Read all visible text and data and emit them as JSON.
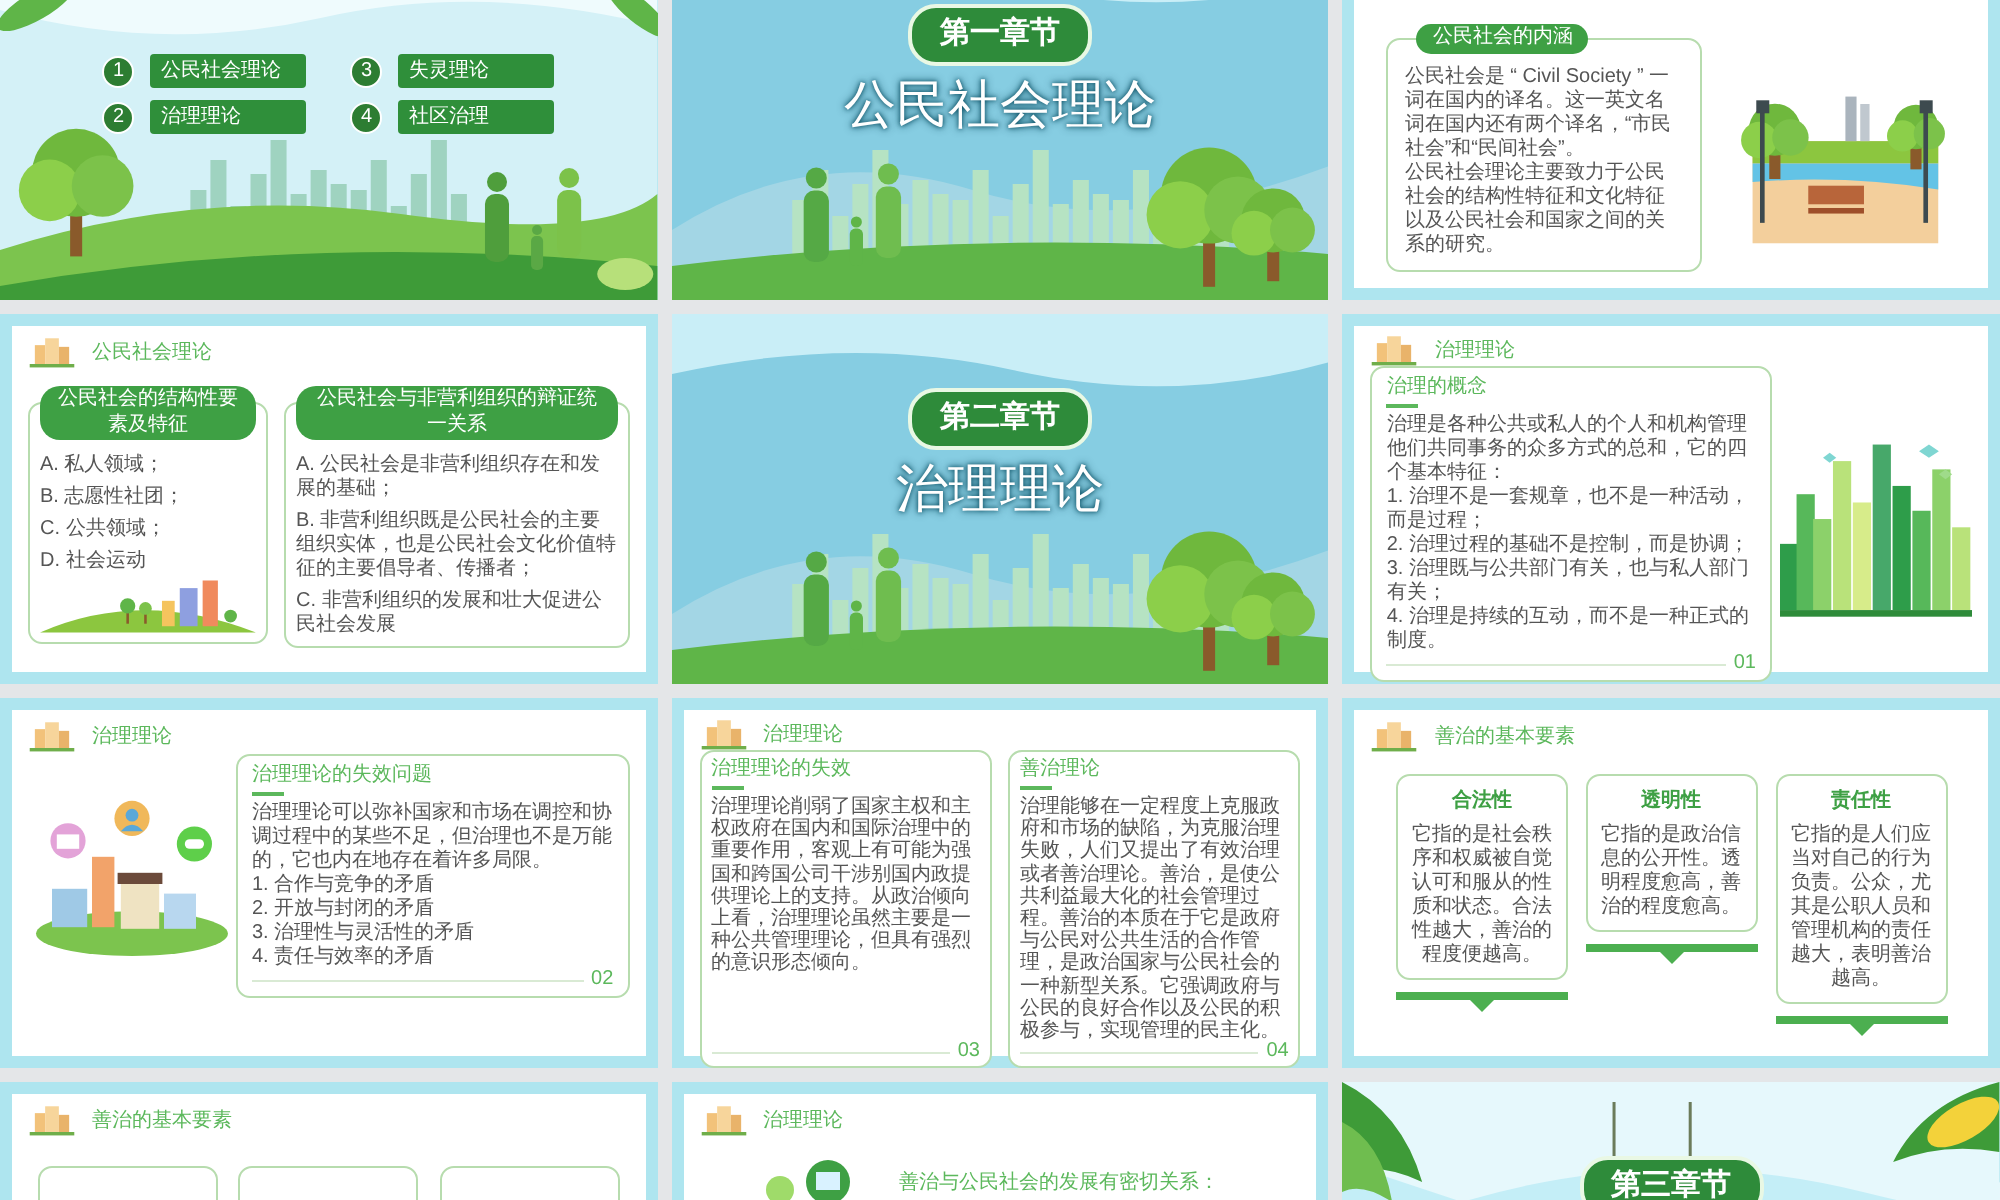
{
  "slides": [
    {
      "kind": "toc",
      "items": [
        {
          "number": "1",
          "label": "公民社会理论"
        },
        {
          "number": "2",
          "label": "治理理论"
        },
        {
          "number": "3",
          "label": "失灵理论"
        },
        {
          "number": "4",
          "label": "社区治理"
        }
      ]
    },
    {
      "kind": "chapter",
      "badge": "第一章节",
      "title": "公民社会理论"
    },
    {
      "kind": "intro",
      "heading": "公民社会的内涵",
      "paragraphs": [
        "公民社会是 “ Civil Society ” 一词在国内的译名。这一英文名词在国内还有两个译名，“市民社会”和“民间社会”。",
        "公民社会理论主要致力于公民社会的结构性特征和文化特征以及公民社会和国家之间的关系的研究。"
      ]
    },
    {
      "kind": "two_lists",
      "header": "公民社会理论",
      "boxes": [
        {
          "title": "公民社会的结构性要素及特征",
          "items": [
            "A. 私人领域；",
            "B. 志愿性社团；",
            "C. 公共领域；",
            "D. 社会运动"
          ]
        },
        {
          "title": "公民社会与非营利组织的辩证统一关系",
          "items": [
            "A. 公民社会是非营利组织存在和发展的基础；",
            "B. 非营利组织既是公民社会的主要组织实体，也是公民社会文化价值特征的主要倡导者、传播者；",
            "C. 非营利组织的发展和壮大促进公民社会发展"
          ]
        }
      ]
    },
    {
      "kind": "chapter",
      "badge": "第二章节",
      "title": "治理理论"
    },
    {
      "kind": "concept_left",
      "header": "治理理论",
      "box": {
        "title": "治理的概念",
        "intro": "治理是各种公共或私人的个人和机构管理他们共同事务的众多方式的总和，它的四个基本特征：",
        "items": [
          "1. 治理不是一套规章，也不是一种活动，而是过程；",
          "2. 治理过程的基础不是控制，而是协调；",
          "3. 治理既与公共部门有关，也与私人部门有关；",
          "4. 治理是持续的互动，而不是一种正式的制度。"
        ],
        "page": "01"
      }
    },
    {
      "kind": "concept_right",
      "header": "治理理论",
      "box": {
        "title": "治理理论的失效问题",
        "intro": "治理理论可以弥补国家和市场在调控和协调过程中的某些不足，但治理也不是万能的，它也内在地存在着许多局限。",
        "items": [
          "1. 合作与竞争的矛盾",
          "2. 开放与封闭的矛盾",
          "3. 治理性与灵活性的矛盾",
          "4. 责任与效率的矛盾"
        ],
        "page": "02"
      }
    },
    {
      "kind": "cards",
      "header": "治理理论",
      "cards": [
        {
          "title": "治理理论的失效",
          "text": "治理理论削弱了国家主权和主权政府在国内和国际治理中的重要作用，客观上有可能为强国和跨国公司干涉别国内政提供理论上的支持。从政治倾向上看，治理理论虽然主要是一种公共管理理论，但具有强烈的意识形态倾向。",
          "page": "03"
        },
        {
          "title": "善治理论",
          "text": "治理能够在一定程度上克服政府和市场的缺陷，为克服治理失败，人们又提出了有效治理或者善治理论。善治，是使公共利益最大化的社会管理过程。善治的本质在于它是政府与公民对公共生活的合作管理，是政治国家与公民社会的一种新型关系。它强调政府与公民的良好合作以及公民的积极参与，实现管理的民主化。",
          "page": "04"
        }
      ]
    },
    {
      "kind": "elements",
      "header": "善治的基本要素",
      "elements": [
        {
          "title": "合法性",
          "text": "它指的是社会秩序和权威被自觉认可和服从的性质和状态。合法性越大，善治的程度便越高。"
        },
        {
          "title": "透明性",
          "text": "它指的是政治信息的公开性。透明程度愈高，善治的程度愈高。"
        },
        {
          "title": "责任性",
          "text": "它指的是人们应当对自己的行为负责。公众，尤其是公职人员和管理机构的责任越大，表明善治越高。"
        }
      ]
    },
    {
      "kind": "blank_cards",
      "header": "善治的基本要素"
    },
    {
      "kind": "lead",
      "header": "治理理论",
      "lead": "善治与公民社会的发展有密切关系："
    },
    {
      "kind": "chapter",
      "badge": "第三章节"
    }
  ]
}
